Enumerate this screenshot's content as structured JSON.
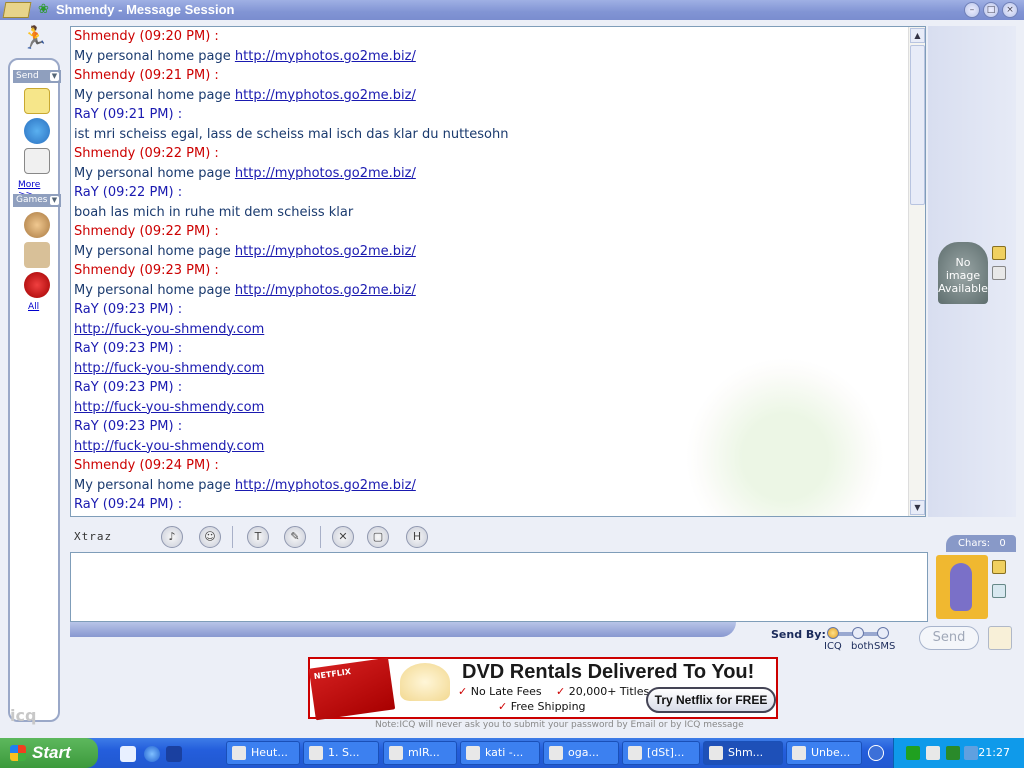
{
  "window": {
    "title": "Shmendy - Message Session"
  },
  "left_toolbar": {
    "send_label": "Send",
    "more_label": "More >>",
    "games_label": "Games",
    "all_label": "All",
    "logo_text": "icq"
  },
  "messages": [
    {
      "sender": "Shmendy (09:20 PM) :",
      "color": "red",
      "text": "My personal home page ",
      "link": "http://myphotos.go2me.biz/"
    },
    {
      "sender": "Shmendy (09:21 PM) :",
      "color": "red",
      "text": "My personal home page ",
      "link": "http://myphotos.go2me.biz/"
    },
    {
      "sender": "RaY (09:21 PM) :",
      "color": "blue",
      "text": "ist mri scheiss egal, lass de scheiss mal isch das klar du nuttesohn",
      "link": ""
    },
    {
      "sender": "Shmendy (09:22 PM) :",
      "color": "red",
      "text": "My personal home page ",
      "link": "http://myphotos.go2me.biz/"
    },
    {
      "sender": "RaY (09:22 PM) :",
      "color": "blue",
      "text": "boah las mich in ruhe mit dem scheiss klar",
      "link": ""
    },
    {
      "sender": "Shmendy (09:22 PM) :",
      "color": "red",
      "text": "My personal home page ",
      "link": "http://myphotos.go2me.biz/"
    },
    {
      "sender": "Shmendy (09:23 PM) :",
      "color": "red",
      "text": "My personal home page ",
      "link": "http://myphotos.go2me.biz/"
    },
    {
      "sender": "RaY (09:23 PM) :",
      "color": "blue",
      "text": "",
      "link": "http://fuck-you-shmendy.com"
    },
    {
      "sender": "RaY (09:23 PM) :",
      "color": "blue",
      "text": "",
      "link": "http://fuck-you-shmendy.com"
    },
    {
      "sender": "RaY (09:23 PM) :",
      "color": "blue",
      "text": "",
      "link": "http://fuck-you-shmendy.com"
    },
    {
      "sender": "RaY (09:23 PM) :",
      "color": "blue",
      "text": "",
      "link": "http://fuck-you-shmendy.com"
    },
    {
      "sender": "Shmendy (09:24 PM) :",
      "color": "red",
      "text": "My personal home page ",
      "link": "http://myphotos.go2me.biz/"
    },
    {
      "sender": "RaY (09:24 PM) :",
      "color": "blue",
      "text": "",
      "link": ""
    }
  ],
  "avatar_panel": {
    "no_image_text": "No image Available"
  },
  "xtraz": {
    "label": "Xtraz"
  },
  "input": {
    "chars_label": "Chars:",
    "chars_count": "0",
    "value": ""
  },
  "send_by": {
    "label": "Send By:",
    "options": [
      "ICQ",
      "both",
      "SMS"
    ],
    "selected": "ICQ"
  },
  "send_button": "Send",
  "ad": {
    "headline": "DVD Rentals Delivered To You!",
    "features": [
      "No Late Fees",
      "20,000+ Titles",
      "Free Shipping"
    ],
    "cta": "Try Netflix for FREE",
    "envelope_text": "NETFLIX"
  },
  "note": "Note:ICQ will never ask you to submit your password by Email or by ICQ message",
  "taskbar": {
    "start_label": "Start",
    "tasks": [
      "Heut...",
      "1. S...",
      "mIR...",
      "kati -...",
      "oga...",
      "[dSt]...",
      "Shm...",
      "Unbe..."
    ],
    "clock": "21:27"
  },
  "colors": {
    "sender_red": "#CC0000",
    "sender_blue": "#1A1AB0",
    "accent": "#8899C8"
  }
}
